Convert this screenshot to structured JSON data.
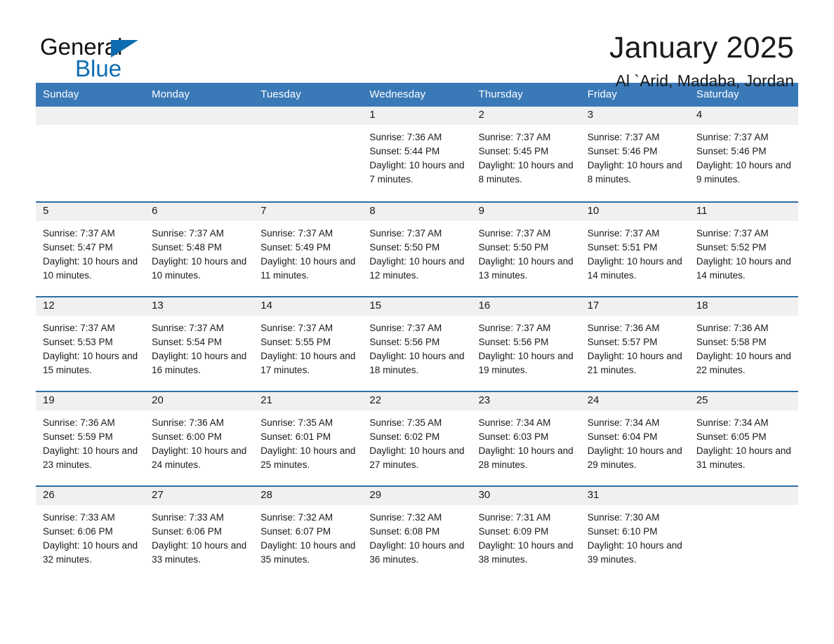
{
  "brand": {
    "name_part1": "General",
    "name_part2": "Blue",
    "triangle_icon": "triangle-logo-icon",
    "accent_color": "#0d6cb0"
  },
  "header": {
    "title": "January 2025",
    "subtitle": "Al `Arid, Madaba, Jordan"
  },
  "colors": {
    "header_blue": "#3a79b8",
    "row_border_blue": "#2e6da4",
    "day_band_gray": "#f0f0f0"
  },
  "weekdays": [
    "Sunday",
    "Monday",
    "Tuesday",
    "Wednesday",
    "Thursday",
    "Friday",
    "Saturday"
  ],
  "weeks": [
    [
      {
        "day": "",
        "sunrise": "",
        "sunset": "",
        "daylight": "",
        "empty": true
      },
      {
        "day": "",
        "sunrise": "",
        "sunset": "",
        "daylight": "",
        "empty": true
      },
      {
        "day": "",
        "sunrise": "",
        "sunset": "",
        "daylight": "",
        "empty": true
      },
      {
        "day": "1",
        "sunrise": "Sunrise: 7:36 AM",
        "sunset": "Sunset: 5:44 PM",
        "daylight": "Daylight: 10 hours and 7 minutes."
      },
      {
        "day": "2",
        "sunrise": "Sunrise: 7:37 AM",
        "sunset": "Sunset: 5:45 PM",
        "daylight": "Daylight: 10 hours and 8 minutes."
      },
      {
        "day": "3",
        "sunrise": "Sunrise: 7:37 AM",
        "sunset": "Sunset: 5:46 PM",
        "daylight": "Daylight: 10 hours and 8 minutes."
      },
      {
        "day": "4",
        "sunrise": "Sunrise: 7:37 AM",
        "sunset": "Sunset: 5:46 PM",
        "daylight": "Daylight: 10 hours and 9 minutes."
      }
    ],
    [
      {
        "day": "5",
        "sunrise": "Sunrise: 7:37 AM",
        "sunset": "Sunset: 5:47 PM",
        "daylight": "Daylight: 10 hours and 10 minutes."
      },
      {
        "day": "6",
        "sunrise": "Sunrise: 7:37 AM",
        "sunset": "Sunset: 5:48 PM",
        "daylight": "Daylight: 10 hours and 10 minutes."
      },
      {
        "day": "7",
        "sunrise": "Sunrise: 7:37 AM",
        "sunset": "Sunset: 5:49 PM",
        "daylight": "Daylight: 10 hours and 11 minutes."
      },
      {
        "day": "8",
        "sunrise": "Sunrise: 7:37 AM",
        "sunset": "Sunset: 5:50 PM",
        "daylight": "Daylight: 10 hours and 12 minutes."
      },
      {
        "day": "9",
        "sunrise": "Sunrise: 7:37 AM",
        "sunset": "Sunset: 5:50 PM",
        "daylight": "Daylight: 10 hours and 13 minutes."
      },
      {
        "day": "10",
        "sunrise": "Sunrise: 7:37 AM",
        "sunset": "Sunset: 5:51 PM",
        "daylight": "Daylight: 10 hours and 14 minutes."
      },
      {
        "day": "11",
        "sunrise": "Sunrise: 7:37 AM",
        "sunset": "Sunset: 5:52 PM",
        "daylight": "Daylight: 10 hours and 14 minutes."
      }
    ],
    [
      {
        "day": "12",
        "sunrise": "Sunrise: 7:37 AM",
        "sunset": "Sunset: 5:53 PM",
        "daylight": "Daylight: 10 hours and 15 minutes."
      },
      {
        "day": "13",
        "sunrise": "Sunrise: 7:37 AM",
        "sunset": "Sunset: 5:54 PM",
        "daylight": "Daylight: 10 hours and 16 minutes."
      },
      {
        "day": "14",
        "sunrise": "Sunrise: 7:37 AM",
        "sunset": "Sunset: 5:55 PM",
        "daylight": "Daylight: 10 hours and 17 minutes."
      },
      {
        "day": "15",
        "sunrise": "Sunrise: 7:37 AM",
        "sunset": "Sunset: 5:56 PM",
        "daylight": "Daylight: 10 hours and 18 minutes."
      },
      {
        "day": "16",
        "sunrise": "Sunrise: 7:37 AM",
        "sunset": "Sunset: 5:56 PM",
        "daylight": "Daylight: 10 hours and 19 minutes."
      },
      {
        "day": "17",
        "sunrise": "Sunrise: 7:36 AM",
        "sunset": "Sunset: 5:57 PM",
        "daylight": "Daylight: 10 hours and 21 minutes."
      },
      {
        "day": "18",
        "sunrise": "Sunrise: 7:36 AM",
        "sunset": "Sunset: 5:58 PM",
        "daylight": "Daylight: 10 hours and 22 minutes."
      }
    ],
    [
      {
        "day": "19",
        "sunrise": "Sunrise: 7:36 AM",
        "sunset": "Sunset: 5:59 PM",
        "daylight": "Daylight: 10 hours and 23 minutes."
      },
      {
        "day": "20",
        "sunrise": "Sunrise: 7:36 AM",
        "sunset": "Sunset: 6:00 PM",
        "daylight": "Daylight: 10 hours and 24 minutes."
      },
      {
        "day": "21",
        "sunrise": "Sunrise: 7:35 AM",
        "sunset": "Sunset: 6:01 PM",
        "daylight": "Daylight: 10 hours and 25 minutes."
      },
      {
        "day": "22",
        "sunrise": "Sunrise: 7:35 AM",
        "sunset": "Sunset: 6:02 PM",
        "daylight": "Daylight: 10 hours and 27 minutes."
      },
      {
        "day": "23",
        "sunrise": "Sunrise: 7:34 AM",
        "sunset": "Sunset: 6:03 PM",
        "daylight": "Daylight: 10 hours and 28 minutes."
      },
      {
        "day": "24",
        "sunrise": "Sunrise: 7:34 AM",
        "sunset": "Sunset: 6:04 PM",
        "daylight": "Daylight: 10 hours and 29 minutes."
      },
      {
        "day": "25",
        "sunrise": "Sunrise: 7:34 AM",
        "sunset": "Sunset: 6:05 PM",
        "daylight": "Daylight: 10 hours and 31 minutes."
      }
    ],
    [
      {
        "day": "26",
        "sunrise": "Sunrise: 7:33 AM",
        "sunset": "Sunset: 6:06 PM",
        "daylight": "Daylight: 10 hours and 32 minutes."
      },
      {
        "day": "27",
        "sunrise": "Sunrise: 7:33 AM",
        "sunset": "Sunset: 6:06 PM",
        "daylight": "Daylight: 10 hours and 33 minutes."
      },
      {
        "day": "28",
        "sunrise": "Sunrise: 7:32 AM",
        "sunset": "Sunset: 6:07 PM",
        "daylight": "Daylight: 10 hours and 35 minutes."
      },
      {
        "day": "29",
        "sunrise": "Sunrise: 7:32 AM",
        "sunset": "Sunset: 6:08 PM",
        "daylight": "Daylight: 10 hours and 36 minutes."
      },
      {
        "day": "30",
        "sunrise": "Sunrise: 7:31 AM",
        "sunset": "Sunset: 6:09 PM",
        "daylight": "Daylight: 10 hours and 38 minutes."
      },
      {
        "day": "31",
        "sunrise": "Sunrise: 7:30 AM",
        "sunset": "Sunset: 6:10 PM",
        "daylight": "Daylight: 10 hours and 39 minutes."
      },
      {
        "day": "",
        "sunrise": "",
        "sunset": "",
        "daylight": "",
        "empty": true
      }
    ]
  ]
}
